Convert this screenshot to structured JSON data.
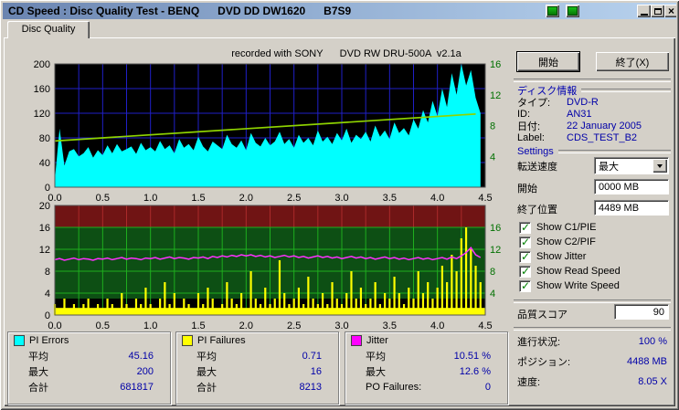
{
  "window": {
    "title": "CD Speed : Disc Quality Test - BENQ      DVD DD DW1620      B7S9"
  },
  "titlebar": {
    "close_glyph": "×"
  },
  "tab_label": "Disc Quality",
  "chart_note": "recorded with SONY      DVD RW DRU-500A  v2.1a",
  "actions": {
    "start": "開始",
    "exit": "終了(X)"
  },
  "disc_info": {
    "header": "ディスク情報",
    "rows": [
      {
        "label": "タイプ:",
        "value": "DVD-R"
      },
      {
        "label": "ID:",
        "value": "AN31"
      },
      {
        "label": "日付:",
        "value": "22 January 2005"
      },
      {
        "label": "Label:",
        "value": "CDS_TEST_B2"
      }
    ]
  },
  "settings": {
    "header": "Settings",
    "transfer_label": "転送速度",
    "transfer_value": "最大",
    "start_label": "開始",
    "start_value": "0000 MB",
    "end_label": "終了位置",
    "end_value": "4489 MB",
    "checkboxes": [
      {
        "label": "Show C1/PIE",
        "checked": true
      },
      {
        "label": "Show C2/PIF",
        "checked": true
      },
      {
        "label": "Show Jitter",
        "checked": true
      },
      {
        "label": "Show Read Speed",
        "checked": true
      },
      {
        "label": "Show Write Speed",
        "checked": true
      }
    ]
  },
  "quality_score": {
    "label": "品質スコア",
    "value": "90"
  },
  "status_rows": [
    {
      "label": "進行状況:",
      "value": "100 %"
    },
    {
      "label": "ポジション:",
      "value": "4488 MB"
    },
    {
      "label": "速度:",
      "value": "8.05 X"
    }
  ],
  "stats_boxes": [
    {
      "title": "PI Errors",
      "swatch": "#00ffff",
      "rows": [
        {
          "label": "平均",
          "value": "45.16"
        },
        {
          "label": "最大",
          "value": "200"
        },
        {
          "label": "合計",
          "value": "681817"
        }
      ]
    },
    {
      "title": "PI Failures",
      "swatch": "#ffff00",
      "rows": [
        {
          "label": "平均",
          "value": "0.71"
        },
        {
          "label": "最大",
          "value": "16"
        },
        {
          "label": "合計",
          "value": "8213"
        }
      ]
    },
    {
      "title": "Jitter",
      "swatch": "#ff00ff",
      "rows": [
        {
          "label": "平均",
          "value": "10.51 %"
        },
        {
          "label": "最大",
          "value": "12.6 %"
        },
        {
          "label": "PO Failures:",
          "value": "0"
        }
      ]
    }
  ],
  "chart_data": [
    {
      "type": "area",
      "name": "PI Errors with read/write speed",
      "x_axis": {
        "min": 0,
        "max": 4.5,
        "ticks": [
          0,
          0.5,
          1,
          1.5,
          2,
          2.5,
          3,
          3.5,
          4,
          4.5
        ],
        "grid_step": 0.25
      },
      "left_axis": {
        "min": 0,
        "max": 200,
        "ticks": [
          0,
          40,
          80,
          120,
          160,
          200
        ]
      },
      "right_axis": {
        "min": 0,
        "max": 16,
        "ticks": [
          4,
          8,
          12,
          16
        ]
      },
      "x_start": 0,
      "x_step": 0.05,
      "pi_errors": [
        12,
        95,
        35,
        58,
        62,
        50,
        55,
        65,
        48,
        60,
        52,
        68,
        55,
        70,
        58,
        62,
        66,
        54,
        72,
        60,
        65,
        58,
        75,
        62,
        68,
        55,
        78,
        64,
        70,
        60,
        82,
        66,
        58,
        74,
        68,
        62,
        85,
        70,
        64,
        76,
        60,
        88,
        72,
        66,
        80,
        68,
        74,
        90,
        70,
        78,
        64,
        85,
        72,
        80,
        68,
        92,
        74,
        82,
        70,
        88,
        76,
        95,
        72,
        85,
        78,
        90,
        74,
        100,
        82,
        92,
        78,
        105,
        88,
        96,
        84,
        110,
        95,
        125,
        105,
        140,
        115,
        160,
        130,
        185,
        150,
        200,
        165,
        190,
        145,
        120
      ],
      "write_speed_line": {
        "x": [
          0,
          4.4
        ],
        "y": [
          6.0,
          9.5
        ],
        "axis": "right"
      },
      "colors": {
        "bg": "#000000",
        "grid": "#2020c8",
        "pi_errors": "#00ffff",
        "write_speed": "#8fd400",
        "axis_right_text": "#007000"
      }
    },
    {
      "type": "bar",
      "name": "PI Failures with jitter",
      "x_axis": {
        "min": 0,
        "max": 4.5,
        "ticks": [
          0,
          0.5,
          1,
          1.5,
          2,
          2.5,
          3,
          3.5,
          4,
          4.5
        ],
        "grid_step": 0.25
      },
      "left_axis": {
        "min": 0,
        "max": 20,
        "ticks": [
          0,
          4,
          8,
          12,
          16,
          20
        ]
      },
      "right_axis": {
        "ticks": [
          4,
          8,
          12,
          16
        ]
      },
      "x_start": 0,
      "x_step": 0.05,
      "base_fill_level": 1.3,
      "pi_failures": [
        2,
        1,
        3,
        1,
        2,
        1,
        2,
        3,
        1,
        2,
        1,
        3,
        2,
        1,
        4,
        2,
        1,
        3,
        2,
        5,
        2,
        1,
        3,
        6,
        2,
        4,
        1,
        3,
        2,
        1,
        4,
        2,
        5,
        3,
        1,
        2,
        6,
        3,
        2,
        4,
        1,
        8,
        3,
        2,
        5,
        2,
        3,
        10,
        4,
        2,
        3,
        5,
        2,
        7,
        3,
        2,
        4,
        2,
        6,
        3,
        2,
        4,
        8,
        3,
        5,
        2,
        3,
        6,
        2,
        4,
        3,
        7,
        4,
        2,
        5,
        3,
        8,
        4,
        6,
        3,
        5,
        9,
        6,
        11,
        8,
        14,
        16,
        12,
        9,
        6
      ],
      "jitter_percent": [
        10.1,
        10.3,
        10.0,
        10.2,
        10.4,
        10.1,
        10.3,
        10.2,
        10.0,
        10.3,
        10.2,
        10.4,
        10.1,
        10.3,
        10.5,
        10.2,
        10.4,
        10.3,
        10.1,
        10.4,
        10.3,
        10.5,
        10.2,
        10.4,
        10.6,
        10.3,
        10.5,
        10.4,
        10.2,
        10.5,
        10.4,
        10.6,
        10.3,
        10.7,
        10.5,
        10.8,
        10.6,
        10.9,
        10.7,
        11.0,
        10.8,
        11.0,
        10.7,
        10.9,
        10.6,
        10.8,
        10.5,
        10.7,
        10.9,
        10.6,
        10.8,
        10.5,
        10.7,
        10.4,
        10.6,
        10.8,
        10.5,
        10.7,
        10.4,
        10.6,
        10.3,
        10.5,
        10.7,
        10.4,
        10.6,
        10.3,
        10.5,
        10.2,
        10.4,
        10.6,
        10.3,
        10.5,
        10.2,
        10.4,
        10.1,
        10.3,
        10.5,
        10.2,
        10.4,
        10.1,
        10.3,
        10.5,
        10.2,
        10.6,
        10.3,
        10.8,
        11.4,
        12.3,
        11.0,
        10.5
      ],
      "zones": [
        {
          "from": 16,
          "to": 20,
          "bg": "#701414",
          "grid": "#aa2a2a"
        },
        {
          "from": 3,
          "to": 16,
          "bg": "#0d4f14",
          "grid": "#1eae1e"
        },
        {
          "from": 0,
          "to": 3,
          "bg": "#000000",
          "grid": "#1eae1e"
        }
      ],
      "colors": {
        "pi_failures": "#ffff00",
        "jitter": "#ff30ff",
        "axis_right_text": "#007000"
      }
    }
  ]
}
